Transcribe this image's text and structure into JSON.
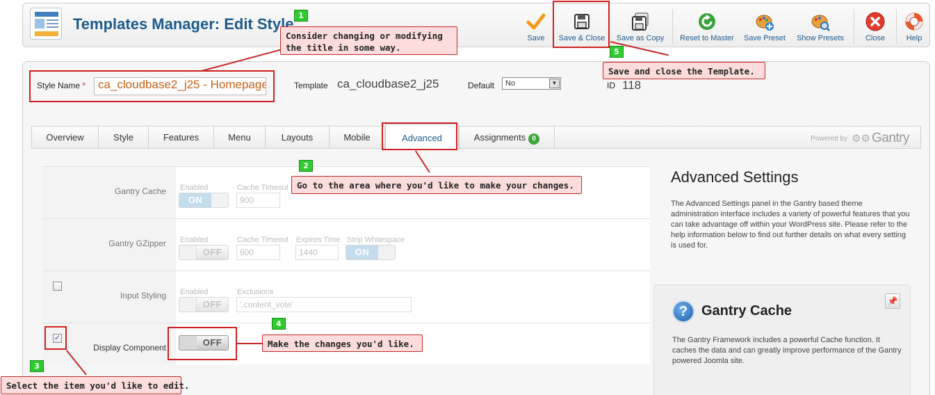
{
  "header": {
    "title": "Templates Manager: Edit Style"
  },
  "toolbar": {
    "save": "Save",
    "save_close": "Save & Close",
    "save_copy": "Save as Copy",
    "reset_master": "Reset to Master",
    "save_preset": "Save Preset",
    "show_presets": "Show Presets",
    "close": "Close",
    "help": "Help"
  },
  "form": {
    "style_name_label": "Style Name",
    "required_mark": "*",
    "style_name_value": "ca_cloudbase2_j25 - Homepage",
    "template_label": "Template",
    "template_value": "ca_cloudbase2_j25",
    "default_label": "Default",
    "default_value": "No",
    "id_label": "ID",
    "id_value": "118"
  },
  "tabs": [
    {
      "label": "Overview"
    },
    {
      "label": "Style"
    },
    {
      "label": "Features"
    },
    {
      "label": "Menu"
    },
    {
      "label": "Layouts"
    },
    {
      "label": "Mobile"
    },
    {
      "label": "Advanced"
    },
    {
      "label": "Assignments",
      "count": "0"
    }
  ],
  "powered": {
    "label": "Powered by",
    "brand": "Gantry"
  },
  "settings": {
    "cache": {
      "label": "Gantry Cache",
      "enabled_label": "Enabled",
      "enabled_value": "ON",
      "timeout_label": "Cache Timeout",
      "timeout_value": "900"
    },
    "gzipper": {
      "label": "Gantry GZipper",
      "enabled_label": "Enabled",
      "enabled_value": "OFF",
      "timeout_label": "Cache Timeout",
      "timeout_value": "600",
      "expires_label": "Expires Time",
      "expires_value": "1440",
      "strip_label": "Strip Whitespace",
      "strip_value": "ON"
    },
    "input_styling": {
      "label": "Input Styling",
      "checked": false,
      "enabled_label": "Enabled",
      "enabled_value": "OFF",
      "exclusions_label": "Exclusions",
      "exclusions_value": "'.content_vote'"
    },
    "display_component": {
      "label": "Display Component",
      "checked": true,
      "check_mark": "✓",
      "enabled_value": "OFF"
    }
  },
  "help": {
    "title": "Advanced Settings",
    "text": "The Advanced Settings panel in the Gantry based theme administration interface includes a variety of powerful features that you can take advantage off within your WordPress site. Please refer to the help information below to find out further details on what every setting is used for.",
    "box_title": "Gantry Cache",
    "box_icon_char": "?",
    "box_text": "The Gantry Framework includes a powerful Cache function. It caches the data and can greatly improve performance of the Gantry powered Joomla site."
  },
  "annotations": [
    {
      "step": "1",
      "line1": "Consider changing or modifying",
      "line2": "the title in some way."
    },
    {
      "step": "2",
      "text": "Go to the area where you'd like to make your changes."
    },
    {
      "step": "3",
      "text": "Select the item you'd like to edit."
    },
    {
      "step": "4",
      "text": "Make the changes you'd like."
    },
    {
      "step": "5",
      "text": "Save and close the Template."
    }
  ],
  "colors": {
    "accent": "#1f5b8c",
    "annotation_red": "#c72828",
    "step_green": "#2fcc2f"
  }
}
